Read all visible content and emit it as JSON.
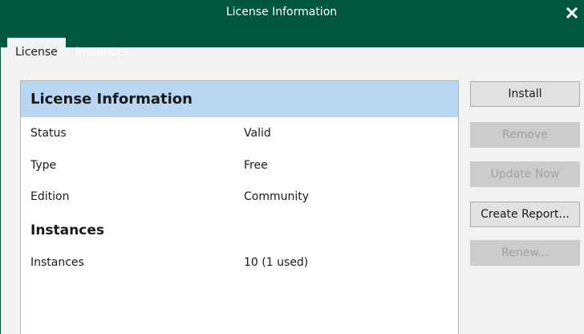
{
  "window": {
    "title": "License Information",
    "close_icon": "close-icon",
    "accent_color": "#00573f",
    "header_color": "#b9d6f3"
  },
  "tabs": [
    {
      "label": "License",
      "active": true
    },
    {
      "label": "Instances",
      "active": false
    }
  ],
  "panel": {
    "header": "License Information",
    "rows": [
      {
        "label": "Status",
        "value": "Valid"
      },
      {
        "label": "Type",
        "value": "Free"
      },
      {
        "label": "Edition",
        "value": "Community"
      }
    ],
    "instances_section": {
      "title": "Instances",
      "rows": [
        {
          "label": "Instances",
          "value": "10 (1 used)"
        }
      ]
    }
  },
  "buttons": [
    {
      "label": "Install",
      "enabled": true
    },
    {
      "label": "Remove",
      "enabled": false
    },
    {
      "label": "Update Now",
      "enabled": false
    },
    {
      "label": "Create Report...",
      "enabled": true
    },
    {
      "label": "Renew...",
      "enabled": false
    }
  ]
}
